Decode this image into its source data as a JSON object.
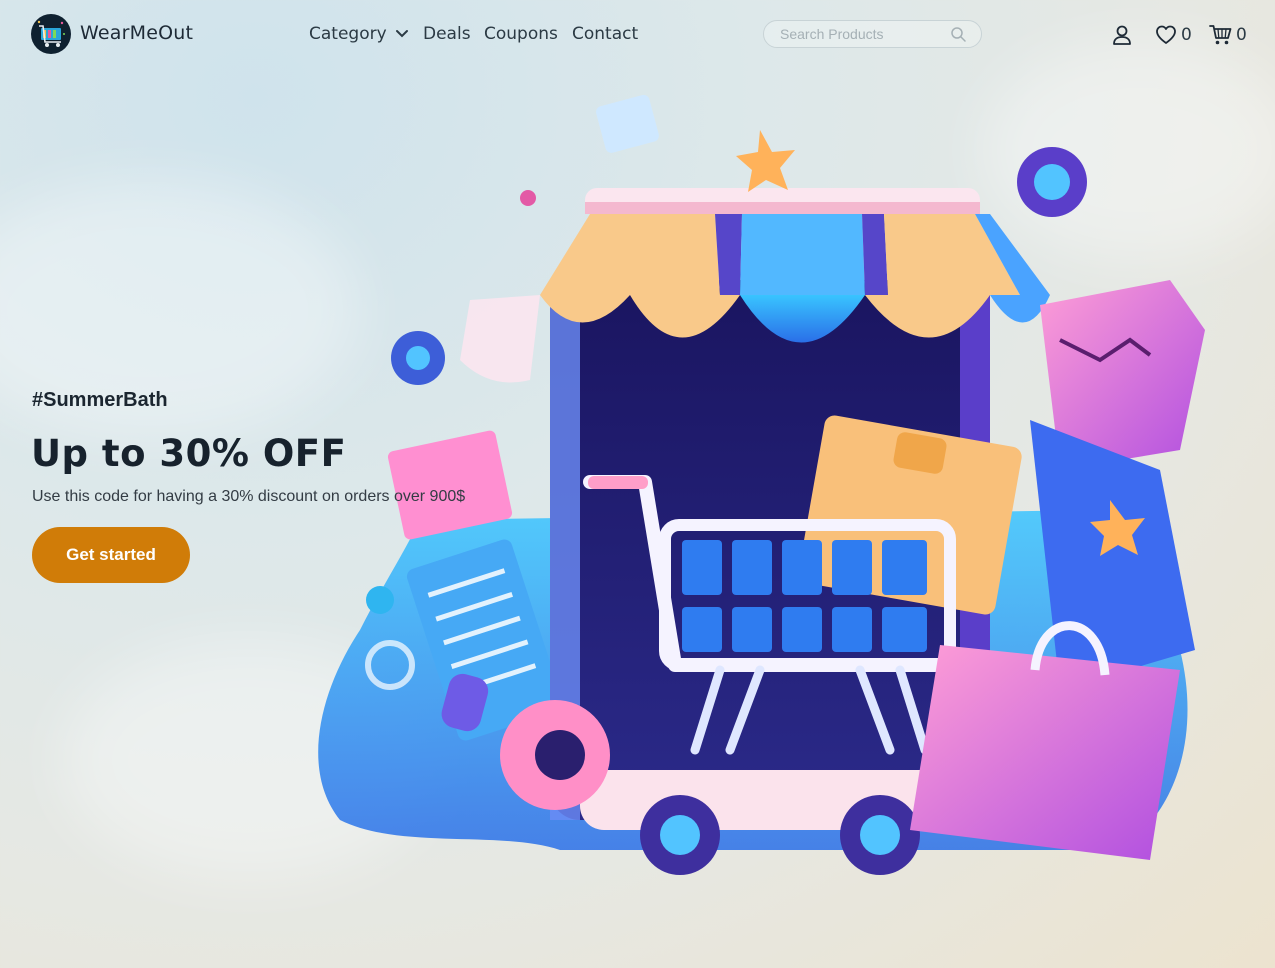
{
  "header": {
    "brand": "WearMeOut",
    "nav": {
      "category": "Category",
      "deals": "Deals",
      "coupons": "Coupons",
      "contact": "Contact"
    },
    "search": {
      "placeholder": "Search Products"
    },
    "wishlist_count": "0",
    "cart_count": "0"
  },
  "hero": {
    "tag": "#SummerBath",
    "headline": "Up to 30% OFF",
    "description": "Use this code for having a 30% discount on orders over 900$",
    "cta_label": "Get started"
  },
  "icons": [
    "logo-icon",
    "chevron-down-icon",
    "search-icon",
    "user-icon",
    "heart-icon",
    "cart-icon"
  ],
  "colors": {
    "accent": "#d07c08",
    "text_dark": "#17222d"
  }
}
